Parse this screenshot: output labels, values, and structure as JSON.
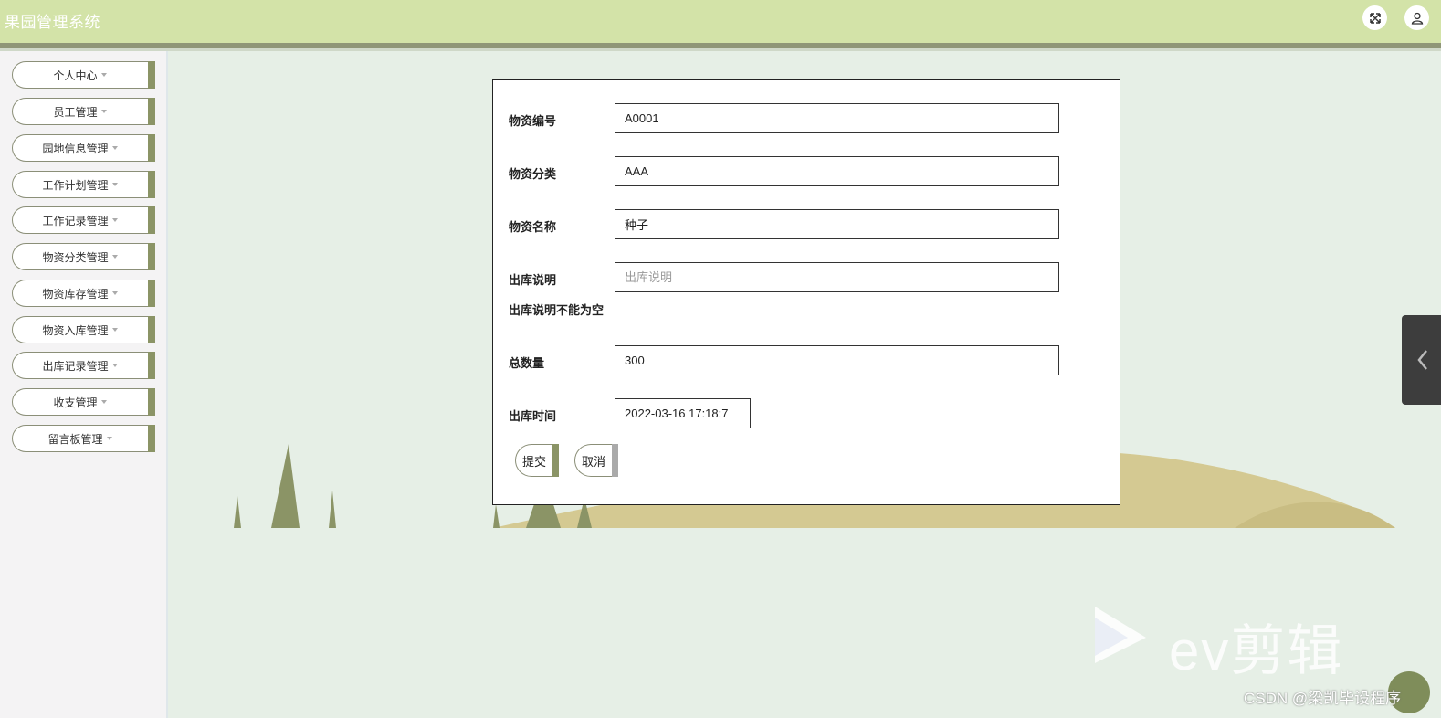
{
  "app": {
    "title": "果园管理系统"
  },
  "header": {
    "fullscreen_icon": "expand-icon",
    "user_icon": "user-icon"
  },
  "sidebar": {
    "items": [
      {
        "label": "个人中心"
      },
      {
        "label": "员工管理"
      },
      {
        "label": "园地信息管理"
      },
      {
        "label": "工作计划管理"
      },
      {
        "label": "工作记录管理"
      },
      {
        "label": "物资分类管理"
      },
      {
        "label": "物资库存管理"
      },
      {
        "label": "物资入库管理"
      },
      {
        "label": "出库记录管理"
      },
      {
        "label": "收支管理"
      },
      {
        "label": "留言板管理"
      }
    ]
  },
  "form": {
    "code": {
      "label": "物资编号",
      "value": "A0001"
    },
    "category": {
      "label": "物资分类",
      "value": "AAA"
    },
    "name": {
      "label": "物资名称",
      "value": "种子"
    },
    "remark": {
      "label": "出库说明",
      "value": "",
      "placeholder": "出库说明"
    },
    "remark_error": "出库说明不能为空",
    "total": {
      "label": "总数量",
      "value": "300"
    },
    "out_time": {
      "label": "出库时间",
      "value": "2022-03-16 17:18:7"
    },
    "submit_label": "提交",
    "cancel_label": "取消"
  },
  "overlay": {
    "ev_logo": "ev剪辑",
    "watermark": "CSDN @梁凯毕设程序"
  },
  "colors": {
    "header_bg": "#d3e3a8",
    "accent": "#8b9466",
    "main_bg": "#e6efe6",
    "hill": "#d4c992"
  }
}
